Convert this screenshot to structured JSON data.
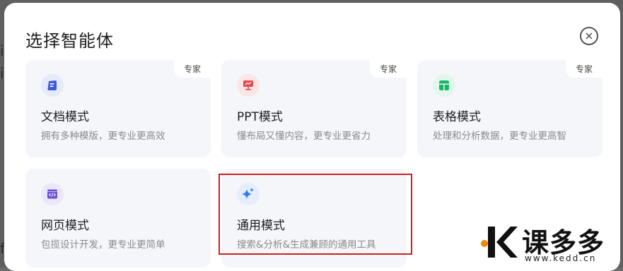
{
  "background": {
    "left_chars": [
      "i",
      "i",
      "f"
    ]
  },
  "dialog": {
    "title": "选择智能体",
    "close_label": "×"
  },
  "cards": [
    {
      "name": "文档模式",
      "description": "拥有多种模版，更专业更高效",
      "badge": "专家",
      "icon": "document-icon",
      "color": "#3b5bdb"
    },
    {
      "name": "PPT模式",
      "description": "懂布局又懂内容，更专业更省力",
      "badge": "专家",
      "icon": "presentation-icon",
      "color": "#e5484d"
    },
    {
      "name": "表格模式",
      "description": "处理和分析数据，更专业更高智",
      "badge": "专家",
      "icon": "table-icon",
      "color": "#12b76a"
    },
    {
      "name": "网页模式",
      "description": "包揽设计开发，更专业更简单",
      "icon": "webpage-code-icon",
      "color": "#6b4fd8"
    },
    {
      "name": "通用模式",
      "description": "搜索&分析&生成兼顾的通用工具",
      "icon": "sparkle-icon",
      "color": "#2f7cf6"
    }
  ],
  "watermark": {
    "brand": "课多多",
    "url": "www.kedd.cn",
    "accent": "#f08c00"
  }
}
